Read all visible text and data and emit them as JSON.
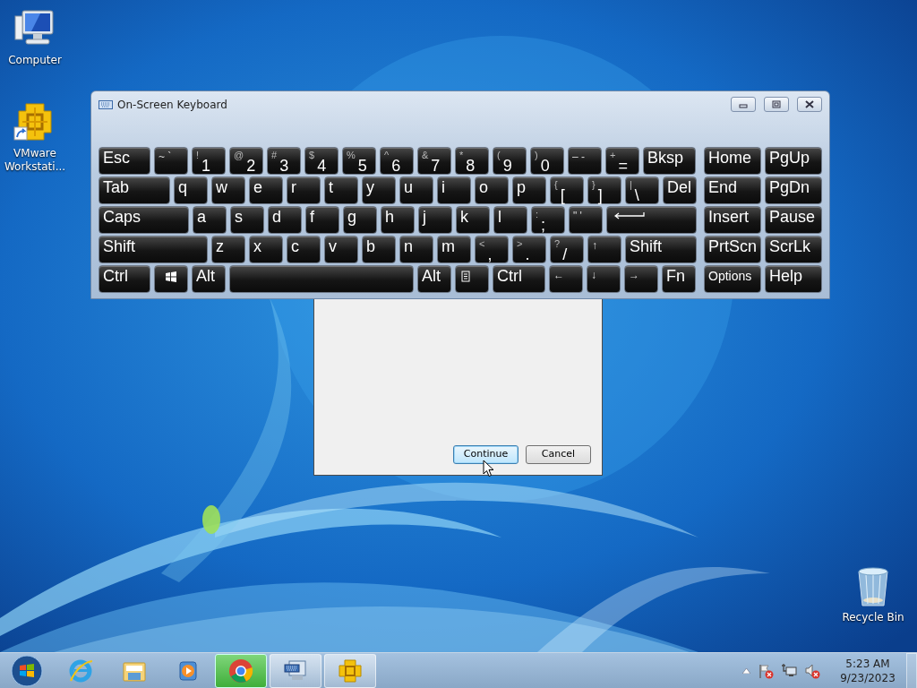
{
  "desktop_icons": [
    {
      "kind": "computer",
      "label": "Computer",
      "shortcut": false
    },
    {
      "kind": "vmware",
      "label": "VMware Workstati...",
      "shortcut": true
    },
    {
      "kind": "recycle-bin",
      "label": "Recycle Bin",
      "shortcut": false
    }
  ],
  "dialog": {
    "buttons": [
      {
        "label": "Continue",
        "focused": true
      },
      {
        "label": "Cancel",
        "focused": false
      }
    ]
  },
  "keyboard_window": {
    "title": "On-Screen Keyboard",
    "main_rows": [
      [
        {
          "kind": "word",
          "label": "Esc"
        },
        {
          "kind": "glyph",
          "label": "~ `"
        },
        {
          "kind": "dual",
          "shift": "!",
          "label": "1"
        },
        {
          "kind": "dual",
          "shift": "@",
          "label": "2"
        },
        {
          "kind": "dual",
          "shift": "#",
          "label": "3"
        },
        {
          "kind": "dual",
          "shift": "$",
          "label": "4"
        },
        {
          "kind": "dual",
          "shift": "%",
          "label": "5"
        },
        {
          "kind": "dual",
          "shift": "^",
          "label": "6"
        },
        {
          "kind": "dual",
          "shift": "&",
          "label": "7"
        },
        {
          "kind": "dual",
          "shift": "*",
          "label": "8"
        },
        {
          "kind": "dual",
          "shift": "(",
          "label": "9"
        },
        {
          "kind": "dual",
          "shift": ")",
          "label": "0"
        },
        {
          "kind": "glyph",
          "label": "– -"
        },
        {
          "kind": "dual",
          "shift": "+",
          "label": "="
        },
        {
          "kind": "word",
          "label": "Bksp"
        }
      ],
      [
        {
          "kind": "word",
          "label": "Tab"
        },
        {
          "kind": "word",
          "label": "q"
        },
        {
          "kind": "word",
          "label": "w"
        },
        {
          "kind": "word",
          "label": "e"
        },
        {
          "kind": "word",
          "label": "r"
        },
        {
          "kind": "word",
          "label": "t"
        },
        {
          "kind": "word",
          "label": "y"
        },
        {
          "kind": "word",
          "label": "u"
        },
        {
          "kind": "word",
          "label": "i"
        },
        {
          "kind": "word",
          "label": "o"
        },
        {
          "kind": "word",
          "label": "p"
        },
        {
          "kind": "dual",
          "shift": "{",
          "label": "["
        },
        {
          "kind": "dual",
          "shift": "}",
          "label": "]"
        },
        {
          "kind": "dual",
          "shift": "|",
          "label": "\\"
        },
        {
          "kind": "word",
          "label": "Del"
        }
      ],
      [
        {
          "kind": "word",
          "label": "Caps"
        },
        {
          "kind": "word",
          "label": "a"
        },
        {
          "kind": "word",
          "label": "s"
        },
        {
          "kind": "word",
          "label": "d"
        },
        {
          "kind": "word",
          "label": "f"
        },
        {
          "kind": "word",
          "label": "g"
        },
        {
          "kind": "word",
          "label": "h"
        },
        {
          "kind": "word",
          "label": "j"
        },
        {
          "kind": "word",
          "label": "k"
        },
        {
          "kind": "word",
          "label": "l"
        },
        {
          "kind": "dual",
          "shift": ":",
          "label": ";"
        },
        {
          "kind": "glyph",
          "label": "\" '"
        },
        {
          "kind": "enter"
        }
      ],
      [
        {
          "kind": "word",
          "label": "Shift"
        },
        {
          "kind": "word",
          "label": "z"
        },
        {
          "kind": "word",
          "label": "x"
        },
        {
          "kind": "word",
          "label": "c"
        },
        {
          "kind": "word",
          "label": "v"
        },
        {
          "kind": "word",
          "label": "b"
        },
        {
          "kind": "word",
          "label": "n"
        },
        {
          "kind": "word",
          "label": "m"
        },
        {
          "kind": "dual",
          "shift": "<",
          "label": ","
        },
        {
          "kind": "dual",
          "shift": ">",
          "label": "."
        },
        {
          "kind": "dual",
          "shift": "?",
          "label": "/"
        },
        {
          "kind": "glyph",
          "label": "↑"
        },
        {
          "kind": "word",
          "label": "Shift"
        }
      ],
      [
        {
          "kind": "word",
          "label": "Ctrl"
        },
        {
          "kind": "windows"
        },
        {
          "kind": "word",
          "label": "Alt"
        },
        {
          "kind": "space"
        },
        {
          "kind": "word",
          "label": "Alt"
        },
        {
          "kind": "menu"
        },
        {
          "kind": "word",
          "label": "Ctrl"
        },
        {
          "kind": "glyph",
          "label": "←"
        },
        {
          "kind": "glyph",
          "label": "↓"
        },
        {
          "kind": "glyph",
          "label": "→"
        },
        {
          "kind": "word",
          "label": "Fn"
        }
      ]
    ],
    "side_rows": [
      [
        {
          "kind": "word",
          "label": "Home"
        },
        {
          "kind": "word",
          "label": "PgUp"
        }
      ],
      [
        {
          "kind": "word",
          "label": "End"
        },
        {
          "kind": "word",
          "label": "PgDn"
        }
      ],
      [
        {
          "kind": "word",
          "label": "Insert"
        },
        {
          "kind": "word",
          "label": "Pause"
        }
      ],
      [
        {
          "kind": "word",
          "label": "PrtScn"
        },
        {
          "kind": "word",
          "label": "ScrLk"
        }
      ],
      [
        {
          "kind": "word-small",
          "label": "Options"
        },
        {
          "kind": "word",
          "label": "Help"
        }
      ]
    ]
  },
  "taskbar": {
    "items": [
      {
        "kind": "internet-explorer",
        "running": false,
        "highlighted": false
      },
      {
        "kind": "explorer",
        "running": false,
        "highlighted": false
      },
      {
        "kind": "media-player",
        "running": false,
        "highlighted": false
      },
      {
        "kind": "chrome",
        "running": true,
        "highlighted": true
      },
      {
        "kind": "on-screen-keyboard",
        "running": true,
        "highlighted": false
      },
      {
        "kind": "vmware",
        "running": true,
        "highlighted": false
      }
    ],
    "time": "5:23 AM",
    "date": "9/23/2023"
  }
}
